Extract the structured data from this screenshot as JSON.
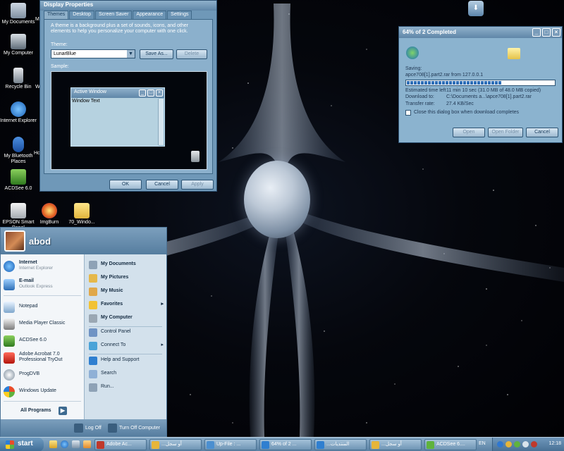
{
  "colors": {
    "accent": "#6f98b8",
    "title": "#5f86a8",
    "start_menu_bg": "#dfe9f1",
    "taskbar": "#5b82a4"
  },
  "desktop": {
    "icons": [
      {
        "label": "My Documents",
        "icon": "my-documents-icon"
      },
      {
        "label": "My Computer",
        "icon": "my-computer-icon"
      },
      {
        "label": "Recycle Bin",
        "icon": "recycle-bin-icon"
      },
      {
        "label": "Internet Explorer",
        "icon": "internet-explorer-icon"
      },
      {
        "label": "My Bluetooth Places",
        "icon": "bluetooth-icon"
      },
      {
        "label": "ACDSee 6.0",
        "icon": "acdsee-icon"
      },
      {
        "label": "EPSON Smart Panel",
        "icon": "epson-icon"
      },
      {
        "label": "ImgBurn",
        "icon": "imgburn-icon"
      },
      {
        "label": "70_Windo...",
        "icon": "folder-icon"
      }
    ],
    "partial_labels": [
      "M",
      "W",
      "Ho"
    ]
  },
  "display_properties": {
    "title": "Display Properties",
    "tabs": [
      "Themes",
      "Desktop",
      "Screen Saver",
      "Appearance",
      "Settings"
    ],
    "description": "A theme is a background plus a set of sounds, icons, and other elements to help you personalize your computer with one click.",
    "theme_label": "Theme:",
    "theme_value": "LunarBlue",
    "save_as": "Save As...",
    "delete": "Delete",
    "sample_label": "Sample:",
    "active_window_title": "Active Window",
    "window_text": "Window Text",
    "ok": "OK",
    "cancel": "Cancel",
    "apply": "Apply"
  },
  "download": {
    "title": "64% of 2 Completed",
    "saving_label": "Saving:",
    "file_line": "apce708[1].part2.rar from 127.0.0.1",
    "progress_fraction": 0.64,
    "estimated_label": "Estimated time left",
    "estimated_value": "11 min 10 sec (31.0 MB of 48.0 MB copied)",
    "download_to_label": "Download to:",
    "download_to_value": "C:\\Documents a...\\apce708[1].part2.rar",
    "rate_label": "Transfer rate:",
    "rate_value": "27.4 KB/Sec",
    "close_checkbox": "Close this dialog box when download completes",
    "open": "Open",
    "open_folder": "Open Folder",
    "cancel": "Cancel"
  },
  "start_menu": {
    "user": "abod",
    "pinned": [
      {
        "title": "Internet",
        "sub": "Internet Explorer",
        "icon": "internet-explorer-icon"
      },
      {
        "title": "E-mail",
        "sub": "Outlook Express",
        "icon": "outlook-express-icon"
      }
    ],
    "recent": [
      {
        "title": "Notepad",
        "sub": "",
        "icon": "notepad-icon"
      },
      {
        "title": "Media Player Classic",
        "sub": "",
        "icon": "media-player-icon"
      },
      {
        "title": "ACDSee 6.0",
        "sub": "",
        "icon": "acdsee-icon"
      },
      {
        "title": "Adobe Acrobat 7.0",
        "sub": "Professional TryOut",
        "icon": "acrobat-icon"
      },
      {
        "title": "ProgDVB",
        "sub": "",
        "icon": "progdvb-icon"
      },
      {
        "title": "Windows Update",
        "sub": "",
        "icon": "windows-update-icon"
      }
    ],
    "all_programs": "All Programs",
    "right": [
      {
        "label": "My Documents",
        "icon": "my-documents-icon",
        "arrow": ""
      },
      {
        "label": "My Pictures",
        "icon": "my-pictures-icon",
        "arrow": ""
      },
      {
        "label": "My Music",
        "icon": "my-music-icon",
        "arrow": ""
      },
      {
        "label": "Favorites",
        "icon": "favorites-icon",
        "arrow": "▸"
      },
      {
        "label": "My Computer",
        "icon": "my-computer-icon",
        "arrow": ""
      },
      {
        "label": "Control Panel",
        "icon": "control-panel-icon",
        "arrow": ""
      },
      {
        "label": "Connect To",
        "icon": "connect-to-icon",
        "arrow": "▸"
      },
      {
        "label": "Help and Support",
        "icon": "help-icon",
        "arrow": ""
      },
      {
        "label": "Search",
        "icon": "search-icon",
        "arrow": ""
      },
      {
        "label": "Run...",
        "icon": "run-icon",
        "arrow": ""
      }
    ],
    "log_off": "Log Off",
    "turn_off": "Turn Off Computer"
  },
  "taskbar": {
    "start": "start",
    "buttons": [
      {
        "label": "Adobe Ac...",
        "icon": "acrobat-icon"
      },
      {
        "label": "...أو سجل",
        "icon": "folder-icon"
      },
      {
        "label": "Up-File : ...",
        "icon": "up-file-icon"
      },
      {
        "label": "64% of 2 ...",
        "icon": "internet-explorer-icon"
      },
      {
        "label": "...المنتديات",
        "icon": "internet-explorer-icon"
      },
      {
        "label": "...أو سجل",
        "icon": "folder-icon"
      },
      {
        "label": "ACDSee 6....",
        "icon": "acdsee-icon"
      }
    ],
    "lang": "EN",
    "clock": "12:18"
  }
}
